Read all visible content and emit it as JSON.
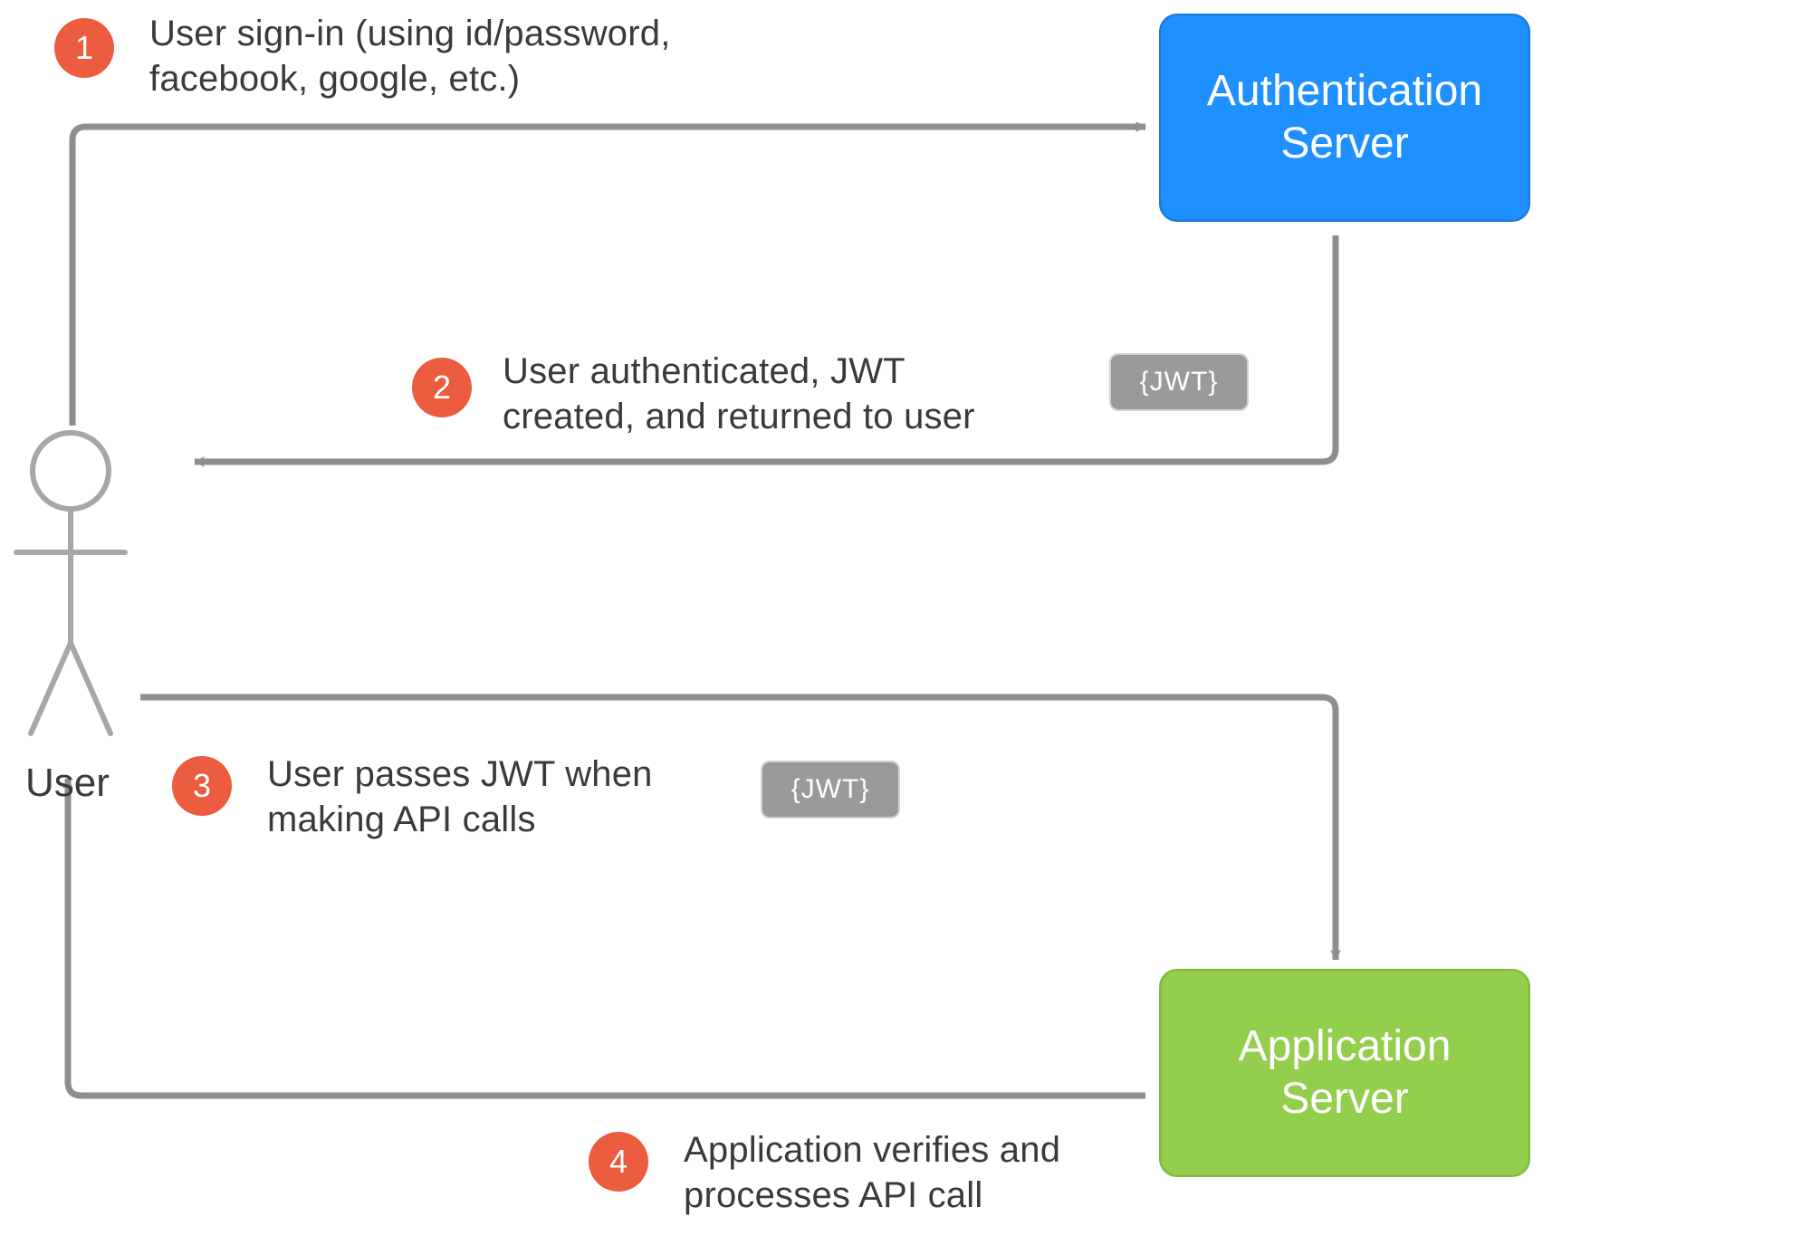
{
  "colors": {
    "badge": "#ec5c3f",
    "arrow": "#8e8e8e",
    "auth_bg": "#1e90ff",
    "auth_border": "#1877e0",
    "app_bg": "#94ce4d",
    "app_border": "#7fb93e",
    "jwt_bg": "#9a9a9a",
    "text": "#3a3a3a",
    "stick": "#a7a7a7"
  },
  "user": {
    "label": "User"
  },
  "servers": {
    "auth": "Authentication\nServer",
    "app": "Application\nServer"
  },
  "steps": {
    "s1": {
      "num": "1",
      "text": "User sign-in (using id/password,\nfacebook, google, etc.)"
    },
    "s2": {
      "num": "2",
      "text": "User authenticated, JWT\ncreated, and returned to user"
    },
    "s3": {
      "num": "3",
      "text": "User passes JWT when\nmaking API calls"
    },
    "s4": {
      "num": "4",
      "text": "Application verifies and\nprocesses API call"
    }
  },
  "jwt": {
    "label": "{JWT}"
  }
}
